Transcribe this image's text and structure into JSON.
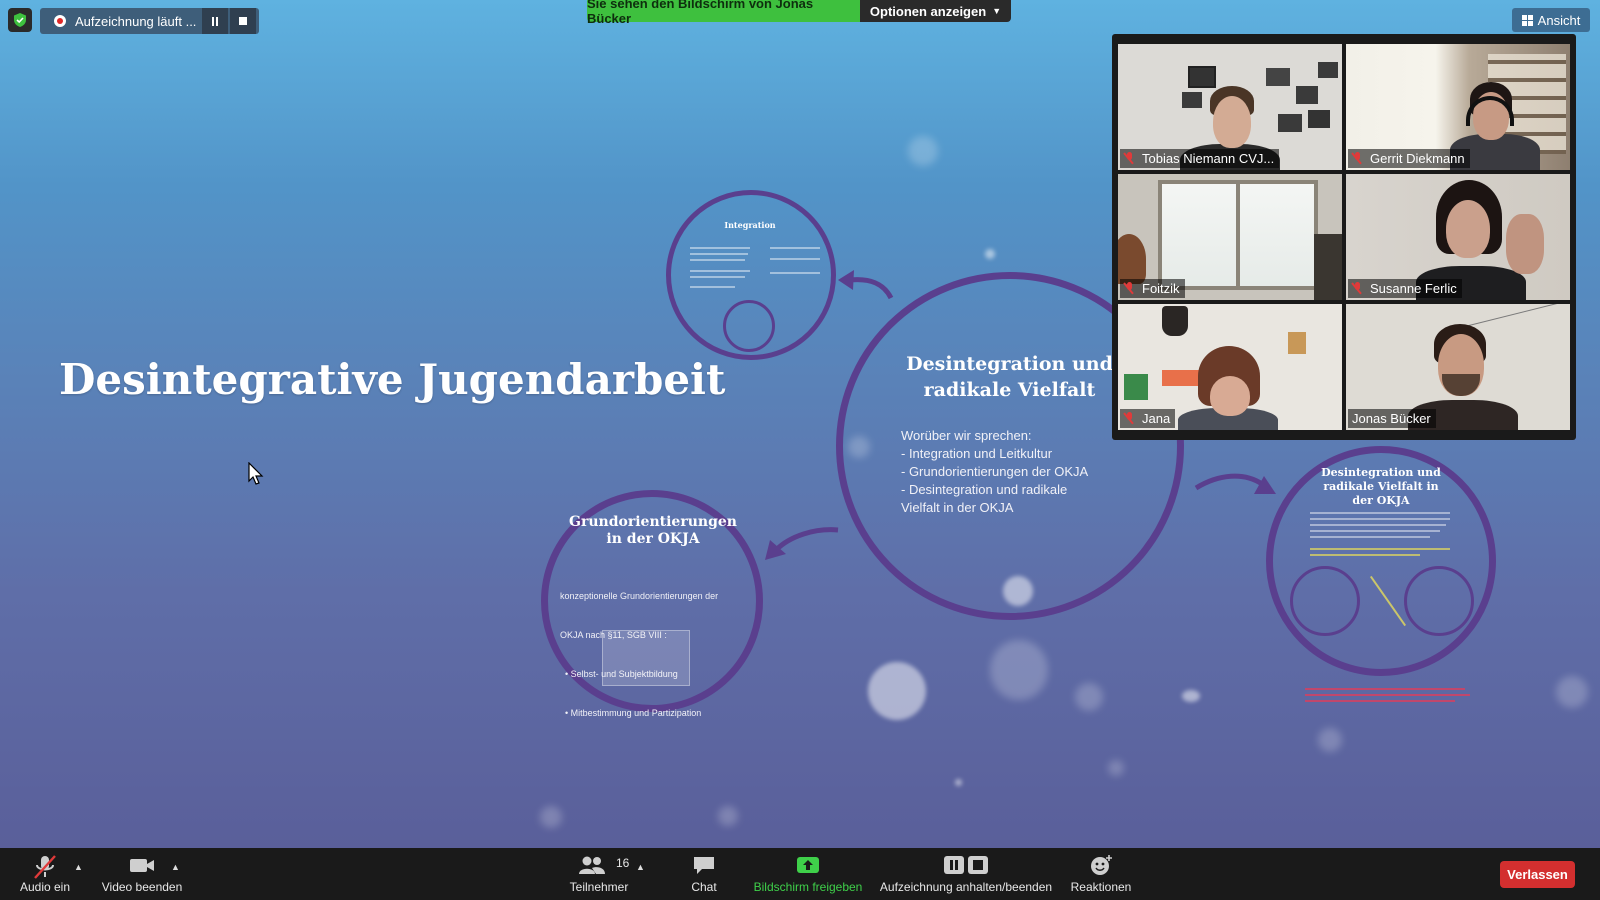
{
  "top_bar": {
    "recording_label": "Aufzeichnung läuft ...",
    "share_banner": "Sie sehen den Bildschirm von Jonas Bücker",
    "options_label": "Optionen anzeigen",
    "view_label": "Ansicht"
  },
  "slide": {
    "main_title": "Desintegrative Jugendarbeit",
    "center": {
      "title_line1": "Desintegration und",
      "title_line2": "radikale Vielfalt",
      "body": [
        "Worüber wir sprechen:",
        "- Integration und Leitkultur",
        "- Grundorientierungen der OKJA",
        "- Desintegration und radikale",
        "Vielfalt in der OKJA"
      ]
    },
    "top_circle": {
      "title": "Integration"
    },
    "left_circle": {
      "title_line1": "Grundorientierungen",
      "title_line2": "in der OKJA",
      "body": [
        "konzeptionelle Grundorientierungen der",
        "OKJA nach §11, SGB VIII :",
        "  • Selbst- und Subjektbildung",
        "  • Mitbestimmung und Partizipation"
      ]
    },
    "right_circle": {
      "title_line1": "Desintegration und",
      "title_line2": "radikale Vielfalt in",
      "title_line3": "der OKJA"
    }
  },
  "participants": [
    {
      "name": "Tobias Niemann CVJ...",
      "muted": true
    },
    {
      "name": "Gerrit Diekmann",
      "muted": true
    },
    {
      "name": "Foitzik",
      "muted": true
    },
    {
      "name": "Susanne Ferlic",
      "muted": true
    },
    {
      "name": "Jana",
      "muted": true
    },
    {
      "name": "Jonas Bücker",
      "muted": false,
      "active_speaker": true
    }
  ],
  "toolbar": {
    "audio_label": "Audio ein",
    "video_label": "Video beenden",
    "participants_label": "Teilnehmer",
    "participants_count": "16",
    "chat_label": "Chat",
    "share_label": "Bildschirm freigeben",
    "recording_label": "Aufzeichnung anhalten/beenden",
    "reactions_label": "Reaktionen",
    "leave_label": "Verlassen"
  },
  "colors": {
    "share_green": "#3ec03e",
    "leave_red": "#d32f2f",
    "circle_purple": "#5a3f8e",
    "active_outline": "#d8e36a"
  }
}
